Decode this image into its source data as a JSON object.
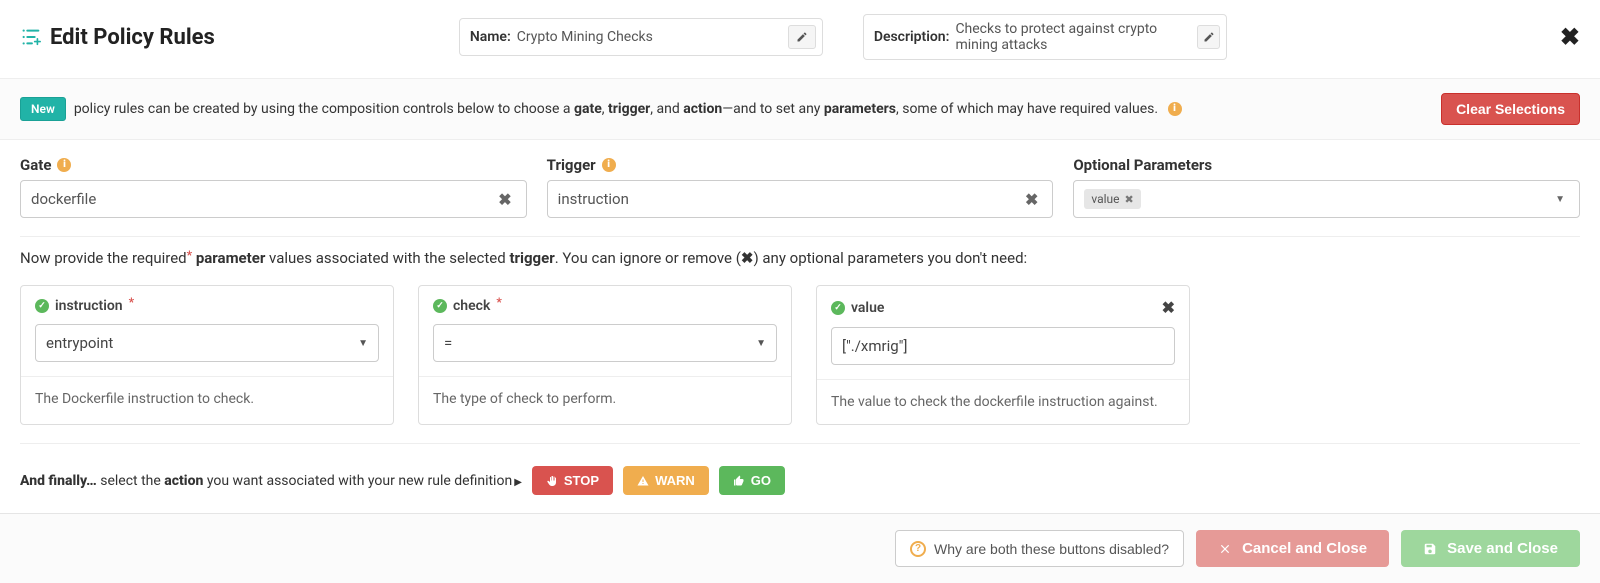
{
  "header": {
    "title": "Edit Policy Rules",
    "name_label": "Name:",
    "name_value": "Crypto Mining Checks",
    "desc_label": "Description:",
    "desc_value": "Checks to protect against crypto mining attacks"
  },
  "intro": {
    "new_badge": "New",
    "text_1": " policy rules can be created by using the composition controls below to choose a ",
    "b1": "gate",
    "sep1": ", ",
    "b2": "trigger",
    "sep2": ", and ",
    "b3": "action",
    "text_2": "—and to set any ",
    "b4": "parameters",
    "text_3": ", some of which may have required values. ",
    "clear_btn": "Clear Selections"
  },
  "selectors": {
    "gate_label": "Gate",
    "gate_value": "dockerfile",
    "trigger_label": "Trigger",
    "trigger_value": "instruction",
    "opt_label": "Optional Parameters",
    "opt_chip": "value"
  },
  "helper": {
    "t1": "Now provide the required",
    "t2": " parameter",
    "t3": " values associated with the selected ",
    "b1": "trigger",
    "t4": ". You can ignore or remove (",
    "x": "✖",
    "t5": ") any optional parameters you don't need:"
  },
  "params": {
    "instruction": {
      "name": "instruction",
      "value": "entrypoint",
      "help": "The Dockerfile instruction to check."
    },
    "check": {
      "name": "check",
      "value": "=",
      "help": "The type of check to perform."
    },
    "value": {
      "name": "value",
      "input": "[\"./xmrig\"]",
      "help": "The value to check the dockerfile instruction against."
    }
  },
  "final": {
    "lead1": "And finally…",
    "lead2": " select the ",
    "b1": "action",
    "lead3": " you want associated with your new rule definition",
    "stop": "STOP",
    "warn": "WARN",
    "go": "GO"
  },
  "footer": {
    "why": "Why are both these buttons disabled?",
    "cancel": "Cancel and Close",
    "save": "Save and Close"
  }
}
